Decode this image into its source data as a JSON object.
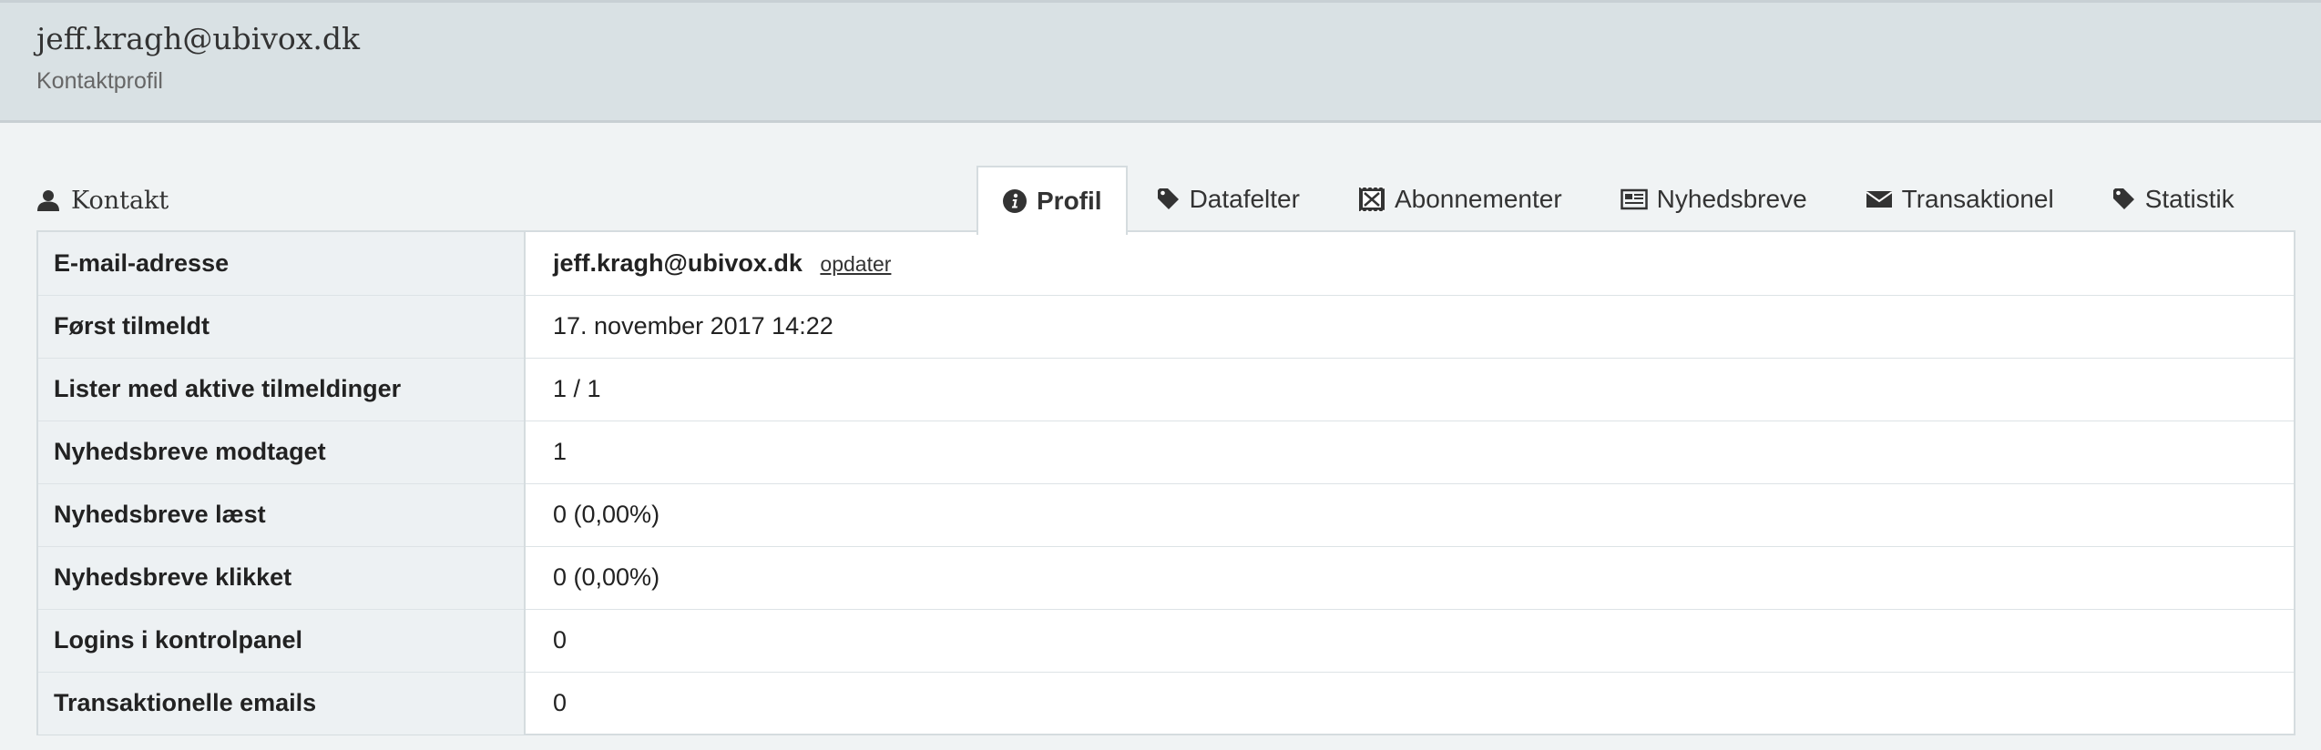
{
  "header": {
    "title": "jeff.kragh@ubivox.dk",
    "subtitle": "Kontaktprofil"
  },
  "section": {
    "title": "Kontakt",
    "icon": "user-icon"
  },
  "tabs": [
    {
      "label": "Profil",
      "icon": "info-circle-icon",
      "active": true
    },
    {
      "label": "Datafelter",
      "icon": "tag-icon",
      "active": false
    },
    {
      "label": "Abonnementer",
      "icon": "stamp-icon",
      "active": false
    },
    {
      "label": "Nyhedsbreve",
      "icon": "newspaper-icon",
      "active": false
    },
    {
      "label": "Transaktionel",
      "icon": "envelope-icon",
      "active": false
    },
    {
      "label": "Statistik",
      "icon": "tag-icon",
      "active": false
    }
  ],
  "profile": {
    "rows": [
      {
        "label": "E-mail-adresse",
        "value": "jeff.kragh@ubivox.dk",
        "link": "opdater"
      },
      {
        "label": "Først tilmeldt",
        "value": "17. november 2017 14:22"
      },
      {
        "label": "Lister med aktive tilmeldinger",
        "value": "1 / 1"
      },
      {
        "label": "Nyhedsbreve modtaget",
        "value": "1"
      },
      {
        "label": "Nyhedsbreve læst",
        "value": "0 (0,00%)"
      },
      {
        "label": "Nyhedsbreve klikket",
        "value": "0 (0,00%)"
      },
      {
        "label": "Logins i kontrolpanel",
        "value": "0"
      },
      {
        "label": "Transaktionelle emails",
        "value": "0"
      }
    ]
  }
}
